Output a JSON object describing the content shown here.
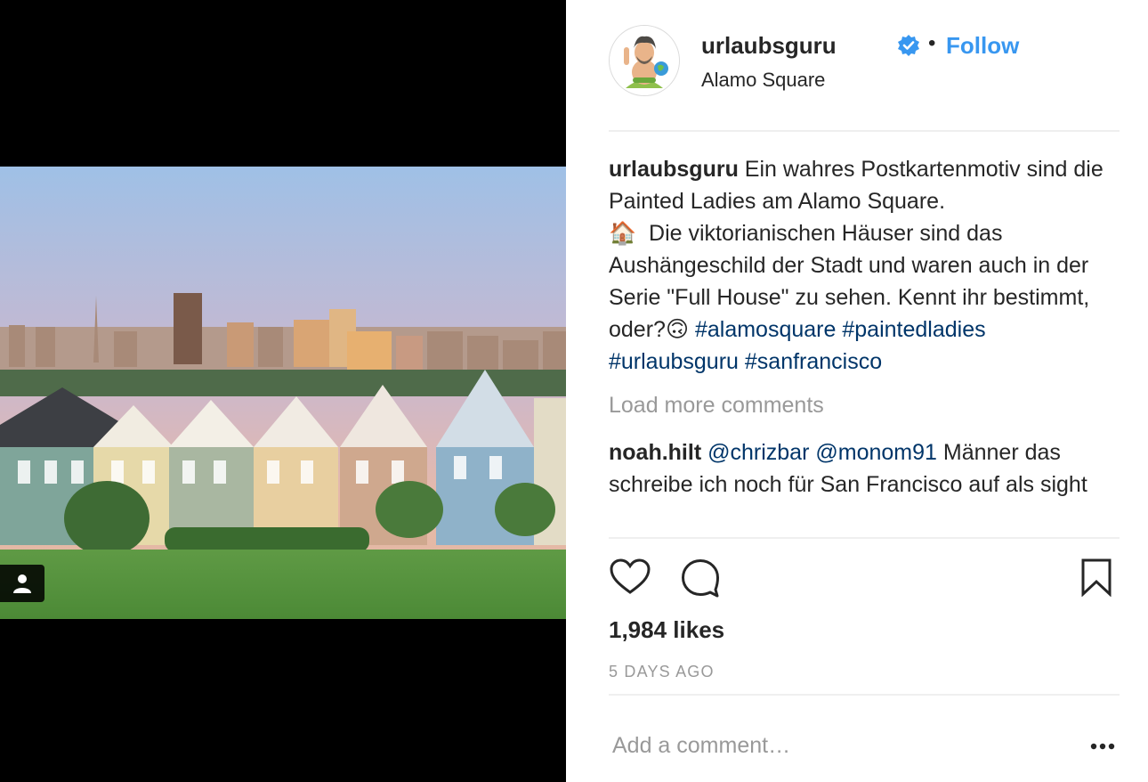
{
  "post": {
    "username": "urlaubsguru",
    "follow_label": "Follow",
    "separator": "•",
    "location": "Alamo Square",
    "caption": {
      "username": "urlaubsguru",
      "text_line1": "Ein wahres Postkartenmotiv sind die Painted Ladies am Alamo Square.",
      "emoji_house": "🏠",
      "text_line2": "Die viktorianischen Häuser sind das Aushängeschild der Stadt und waren auch in der Serie \"Full House\" zu sehen. Kennt ihr bestimmt, oder?",
      "emoji_face": "🙃",
      "hashtags": [
        "#alamosquare",
        "#paintedladies",
        "#urlaubsguru",
        "#sanfrancisco"
      ]
    },
    "load_more_label": "Load more comments",
    "comment": {
      "username": "noah.hilt",
      "mentions": [
        "@chrizbar",
        "@monom91"
      ],
      "text": "Männer das schreibe ich noch für San Francisco auf als sight"
    },
    "likes": "1,984 likes",
    "timestamp": "5 DAYS AGO",
    "add_comment_placeholder": "Add a comment…",
    "more_options_icon": "ellipsis-icon"
  },
  "colors": {
    "link_blue": "#3897f0",
    "hashtag_blue": "#003569",
    "muted_gray": "#999999",
    "text": "#262626",
    "divider": "#efefef"
  }
}
